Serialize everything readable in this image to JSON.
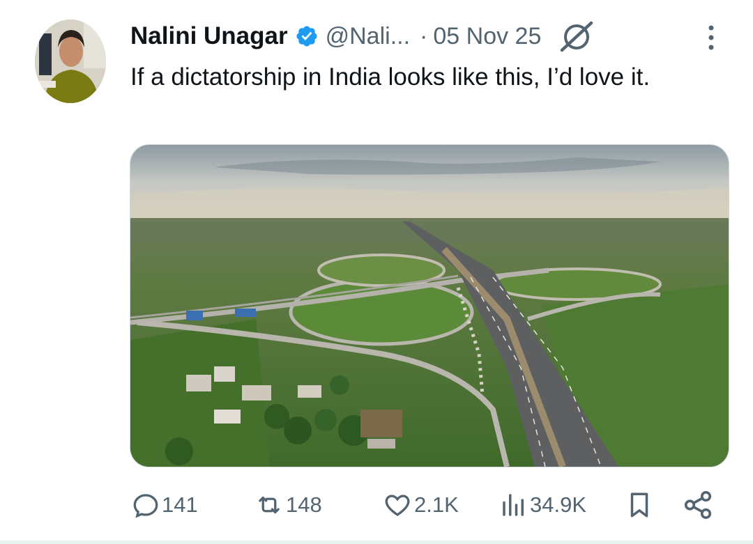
{
  "tweet": {
    "author_name": "Nalini Unagar",
    "handle": "@Nali...",
    "separator": "·",
    "date": "05 Nov 25",
    "text": "If a dictatorship in India looks like this, I’d love it.",
    "verified": true,
    "icons": {
      "verified": "verified-badge-icon",
      "grok": "grok-icon",
      "more": "more-vertical-icon"
    },
    "media": {
      "description_icon": "aerial-photo-highway-interchange"
    }
  },
  "actions": {
    "replies": "141",
    "reposts": "148",
    "likes": "2.1K",
    "views": "34.9K",
    "icons": [
      "reply-icon",
      "repost-icon",
      "like-icon",
      "views-icon",
      "bookmark-icon",
      "share-icon"
    ]
  },
  "colors": {
    "accent": "#1d9bf0",
    "secondary_text": "#536471",
    "primary_text": "#0f1419"
  }
}
